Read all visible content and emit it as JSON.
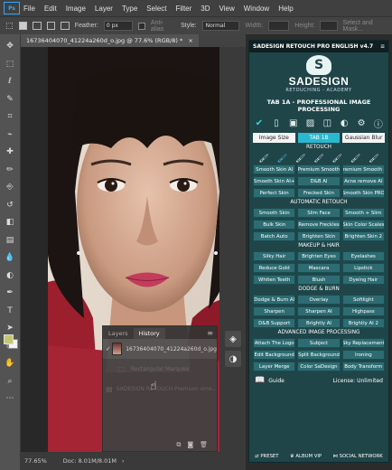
{
  "menu": [
    "File",
    "Edit",
    "Image",
    "Layer",
    "Type",
    "Select",
    "Filter",
    "3D",
    "View",
    "Window",
    "Help"
  ],
  "options": {
    "feather_label": "Feather:",
    "feather_value": "0 px",
    "antialias_label": "Anti-alias",
    "style_label": "Style:",
    "style_value": "Normal",
    "width_label": "Width:",
    "height_label": "Height:",
    "select_mask_label": "Select and Mask..."
  },
  "document": {
    "tab_title": "16736404070_41224a260d_o.jpg @ 77.6% (RGB/8) *",
    "zoom": "77.65%",
    "doc_size": "Doc: 8.01M/8.01M"
  },
  "history": {
    "tabs": [
      "Layers",
      "History"
    ],
    "active_tab": "History",
    "items": [
      {
        "label": "16736404070_41224a260d_o.jpg",
        "state": "selected"
      },
      {
        "label": "Rectangular Marquee",
        "state": "dim"
      },
      {
        "label": "SADESIGN RETOUCH Premium smo...",
        "state": "dim"
      }
    ]
  },
  "plugin": {
    "header": "SADESIGN RETOUCH PRO ENGLISH v4.7",
    "brand": "SADESIGN",
    "brand_sub": "RETOUCHING - ACADEMY",
    "tab_title": "TAB 1A - PROFESSIONAL IMAGE PROCESSING",
    "segments": [
      "Image Size",
      "TAB 1B",
      "Gaussian Blur"
    ],
    "active_segment": "TAB 1B",
    "sections": [
      {
        "title": "RETOUCH",
        "buttons": [
          "Smooth Skin AI",
          "Premium Smooth",
          "Premium Smooth 2",
          "Smooth Skin AI+",
          "D&B AI",
          "Acne remove AI",
          "Perfect Skin",
          "Frecked Skin",
          "Smooth Skin PRO"
        ]
      },
      {
        "title": "AUTOMATIC RETOUCH",
        "buttons": [
          "Smooth Skin",
          "Slim Face",
          "Smooth + Slim",
          "Bulk Skin",
          "Remove Freckles",
          "Skin Color Scales",
          "Batch Auto",
          "Brighten Skin",
          "Brighten Skin 2"
        ]
      },
      {
        "title": "MAKEUP & HAIR",
        "buttons": [
          "Silky Hair",
          "Brighten Eyes",
          "Eyelashes",
          "Reduce Gold",
          "Mascara",
          "Lipstick",
          "Whiten Teeth",
          "Blush",
          "Dyeing Hair"
        ]
      },
      {
        "title": "DODGE & BURN",
        "buttons": [
          "Dodge & Burn AI",
          "Overlay",
          "Softlight",
          "Sharpen",
          "Sharpen AI",
          "Highpass",
          "D&B Support",
          "Brightly AI",
          "Brightly AI 2"
        ]
      },
      {
        "title": "ADVANCED IMAGE PROCESSING",
        "buttons": [
          "Attach The Logo",
          "Subject",
          "Sky Replacement",
          "Edit Background",
          "Split Background",
          "Ironing",
          "Layer Merge",
          "Color SaDesign",
          "Body Transform"
        ]
      }
    ],
    "guide_label": "Guide",
    "license": "License: Unlimited",
    "bottom": [
      "PRESET",
      "ALBUM VIP",
      "SOCIAL NETWORK"
    ]
  },
  "colors": {
    "plugin_bg": "#1f4548",
    "button": "#2d6c72",
    "accent": "#2ab8cf",
    "foreground_swatch": "#c3c86e"
  }
}
